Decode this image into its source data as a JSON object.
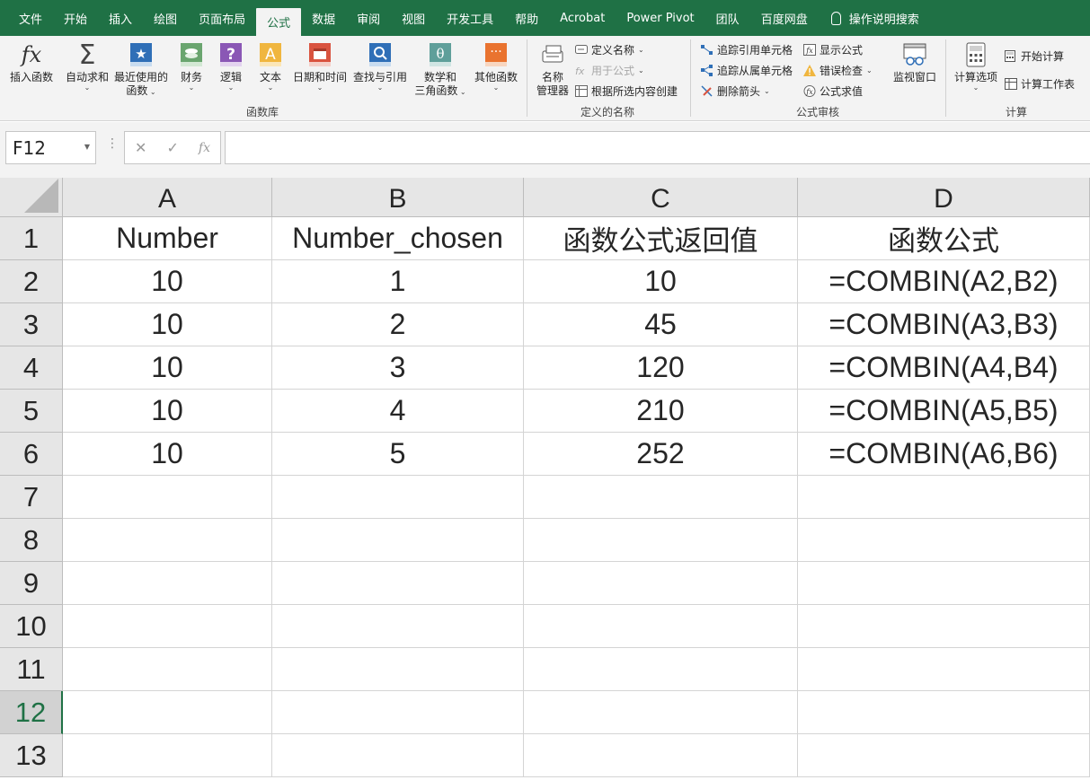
{
  "menu": {
    "items": [
      "文件",
      "开始",
      "插入",
      "绘图",
      "页面布局",
      "公式",
      "数据",
      "审阅",
      "视图",
      "开发工具",
      "帮助",
      "Acrobat",
      "Power Pivot",
      "团队",
      "百度网盘"
    ],
    "active": "公式",
    "search": "操作说明搜索"
  },
  "ribbon": {
    "function_library": {
      "insert_function": "插入函数",
      "autosum": "自动求和",
      "recent_l1": "最近使用的",
      "recent_l2": "函数",
      "financial": "财务",
      "logical": "逻辑",
      "text": "文本",
      "datetime": "日期和时间",
      "lookup": "查找与引用",
      "math_l1": "数学和",
      "math_l2": "三角函数",
      "more": "其他函数",
      "group_label": "函数库"
    },
    "defined_names": {
      "name_manager_l1": "名称",
      "name_manager_l2": "管理器",
      "define_name": "定义名称",
      "use_in_formula": "用于公式",
      "create_from_selection": "根据所选内容创建",
      "group_label": "定义的名称"
    },
    "formula_auditing": {
      "trace_precedents": "追踪引用单元格",
      "trace_dependents": "追踪从属单元格",
      "remove_arrows": "删除箭头",
      "show_formulas": "显示公式",
      "error_checking": "错误检查",
      "evaluate_formula": "公式求值",
      "watch_window": "监视窗口",
      "group_label": "公式审核"
    },
    "calculation": {
      "options": "计算选项",
      "calc_now": "开始计算",
      "calc_sheet": "计算工作表",
      "group_label": "计算"
    }
  },
  "formula_bar": {
    "name_box": "F12",
    "cancel_icon": "✕",
    "enter_icon": "✓",
    "fx_icon": "fx",
    "content": ""
  },
  "sheet": {
    "columns": [
      "A",
      "B",
      "C",
      "D"
    ],
    "row_numbers": [
      "1",
      "2",
      "3",
      "4",
      "5",
      "6",
      "7",
      "8",
      "9",
      "10",
      "11",
      "12",
      "13"
    ],
    "selected_row": "12",
    "rows": [
      [
        "Number",
        "Number_chosen",
        "函数公式返回值",
        "函数公式"
      ],
      [
        "10",
        "1",
        "10",
        "=COMBIN(A2,B2)"
      ],
      [
        "10",
        "2",
        "45",
        "=COMBIN(A3,B3)"
      ],
      [
        "10",
        "3",
        "120",
        "=COMBIN(A4,B4)"
      ],
      [
        "10",
        "4",
        "210",
        "=COMBIN(A5,B5)"
      ],
      [
        "10",
        "5",
        "252",
        "=COMBIN(A6,B6)"
      ]
    ]
  },
  "colors": {
    "brand": "#1f7145",
    "ribbon_bg": "#f3f3f3",
    "header_bg": "#e6e6e6",
    "gridline": "#d4d4d4"
  }
}
